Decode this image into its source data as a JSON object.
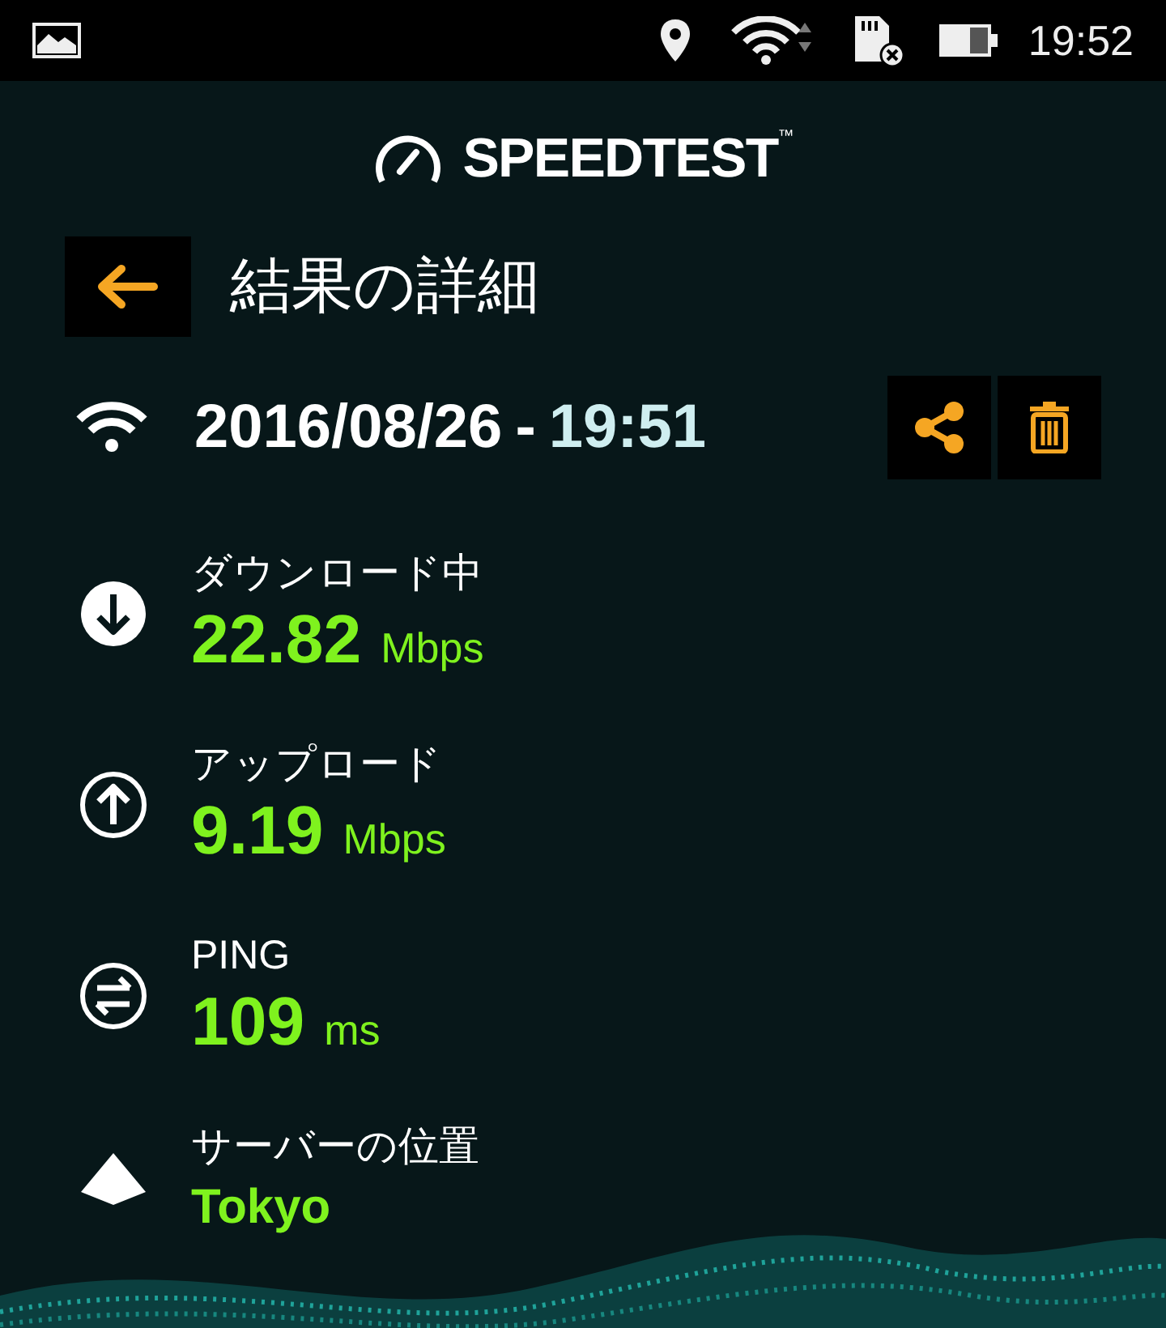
{
  "status_bar": {
    "time": "19:52"
  },
  "app_title": "SPEEDTEST",
  "trademark": "™",
  "header": {
    "title": "結果の詳細"
  },
  "result": {
    "date": "2016/08/26",
    "separator": "-",
    "time": "19:51"
  },
  "metrics": [
    {
      "kind": "download",
      "label": "ダウンロード中",
      "value": "22.82",
      "unit": "Mbps"
    },
    {
      "kind": "upload",
      "label": "アップロード",
      "value": "9.19",
      "unit": "Mbps"
    },
    {
      "kind": "ping",
      "label": "PING",
      "value": "109",
      "unit": "ms"
    },
    {
      "kind": "server",
      "label": "サーバーの位置",
      "value": "Tokyo"
    }
  ]
}
